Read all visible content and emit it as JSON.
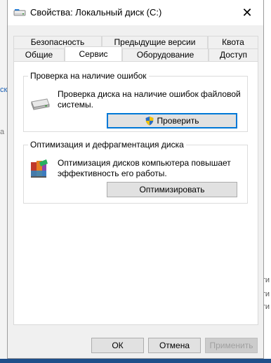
{
  "background": {
    "left_fragments": [
      "ски",
      "а"
    ],
    "right_fragments": [
      "сти",
      "сти",
      "сти"
    ]
  },
  "window": {
    "title": "Свойства: Локальный диск (C:)",
    "close_glyph": "✕"
  },
  "tabs": {
    "row1": [
      {
        "label": "Безопасность"
      },
      {
        "label": "Предыдущие версии"
      },
      {
        "label": "Квота"
      }
    ],
    "row2": [
      {
        "label": "Общие"
      },
      {
        "label": "Сервис",
        "active": true
      },
      {
        "label": "Оборудование"
      },
      {
        "label": "Доступ"
      }
    ]
  },
  "error_check": {
    "title": "Проверка на наличие ошибок",
    "description": "Проверка диска на наличие ошибок файловой системы.",
    "button_label": "Проверить",
    "icon": "drive-icon"
  },
  "optimize": {
    "title": "Оптимизация и дефрагментация диска",
    "description": "Оптимизация дисков компьютера повышает эффективность его работы.",
    "button_label": "Оптимизировать",
    "icon": "defrag-icon"
  },
  "footer": {
    "ok_label": "ОК",
    "cancel_label": "Отмена",
    "apply_label": "Применить"
  },
  "colors": {
    "focus_border": "#0078d7",
    "dialog_bg": "#f0f0f0",
    "page_bg": "#ffffff"
  }
}
